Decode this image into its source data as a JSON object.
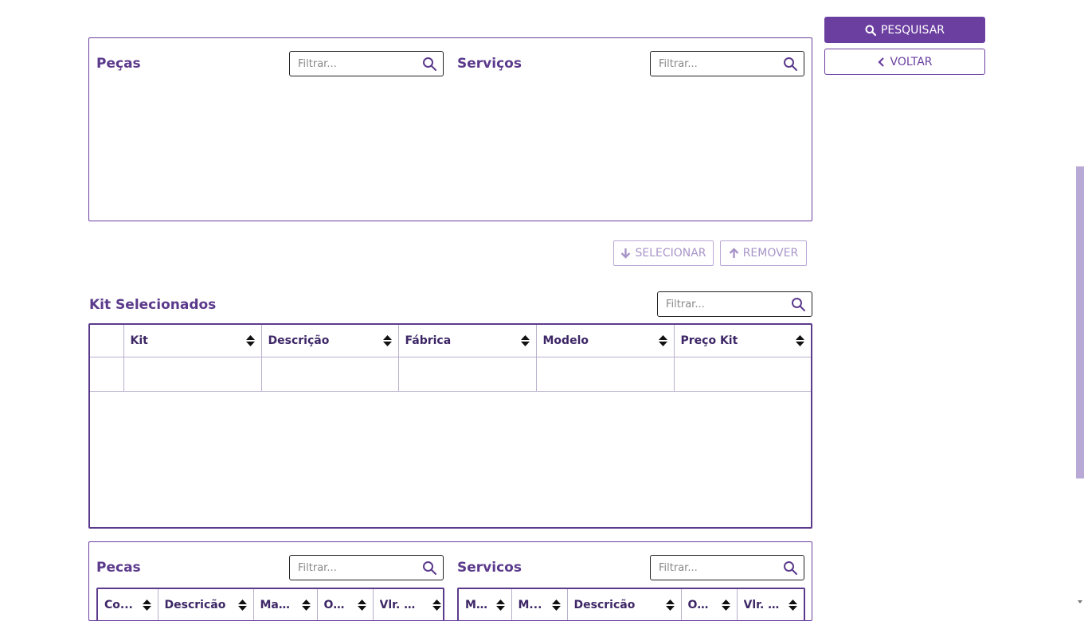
{
  "actions": {
    "search_label": "PESQUISAR",
    "back_label": "VOLTAR"
  },
  "top_panel": {
    "pecas_title": "Peças",
    "pecas_filter_placeholder": "Filtrar...",
    "servicos_title": "Serviços",
    "servicos_filter_placeholder": "Filtrar..."
  },
  "transfer": {
    "select_label": "SELECIONAR",
    "remove_label": "REMOVER"
  },
  "kit": {
    "title": "Kit Selecionados",
    "filter_placeholder": "Filtrar...",
    "columns": [
      "Kit",
      "Descrição",
      "Fábrica",
      "Modelo",
      "Preço Kit"
    ]
  },
  "bottom_panel": {
    "pecas_title": "Pecas",
    "pecas_filter_placeholder": "Filtrar...",
    "pecas_columns": [
      "Co...",
      "Descricão",
      "Mar...",
      "Ot...",
      "Vlr. Uni..."
    ],
    "servicos_title": "Servicos",
    "servicos_filter_placeholder": "Filtrar...",
    "servicos_columns": [
      "M...",
      "M...",
      "Descricão",
      "Ot...",
      "Vlr. ..."
    ]
  },
  "colors": {
    "accent": "#6b3fa0",
    "text": "#5b3a8c"
  },
  "icons": [
    "search-icon",
    "chevron-left-icon",
    "arrow-down-icon",
    "arrow-up-icon",
    "sort-icon",
    "scroll-down-icon"
  ]
}
